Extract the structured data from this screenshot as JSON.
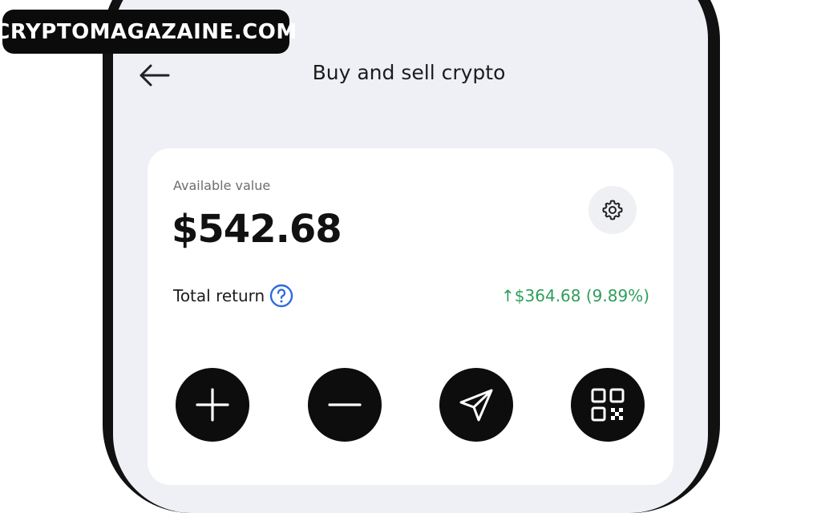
{
  "watermark": {
    "text": "CRYPTOMAGAZAINE.COM"
  },
  "header": {
    "title": "Buy and sell crypto",
    "back_icon": "arrow-left-icon"
  },
  "card": {
    "available_label": "Available value",
    "balance": "$542.68",
    "settings_icon": "gear-icon",
    "total_return_label": "Total return",
    "help_icon": "question-circle-icon",
    "total_return_value": "↑$364.68 (9.89%)",
    "return_color": "#2e9e5b"
  },
  "actions": [
    {
      "icon": "plus-icon"
    },
    {
      "icon": "minus-icon"
    },
    {
      "icon": "send-icon"
    },
    {
      "icon": "qr-code-icon"
    }
  ]
}
